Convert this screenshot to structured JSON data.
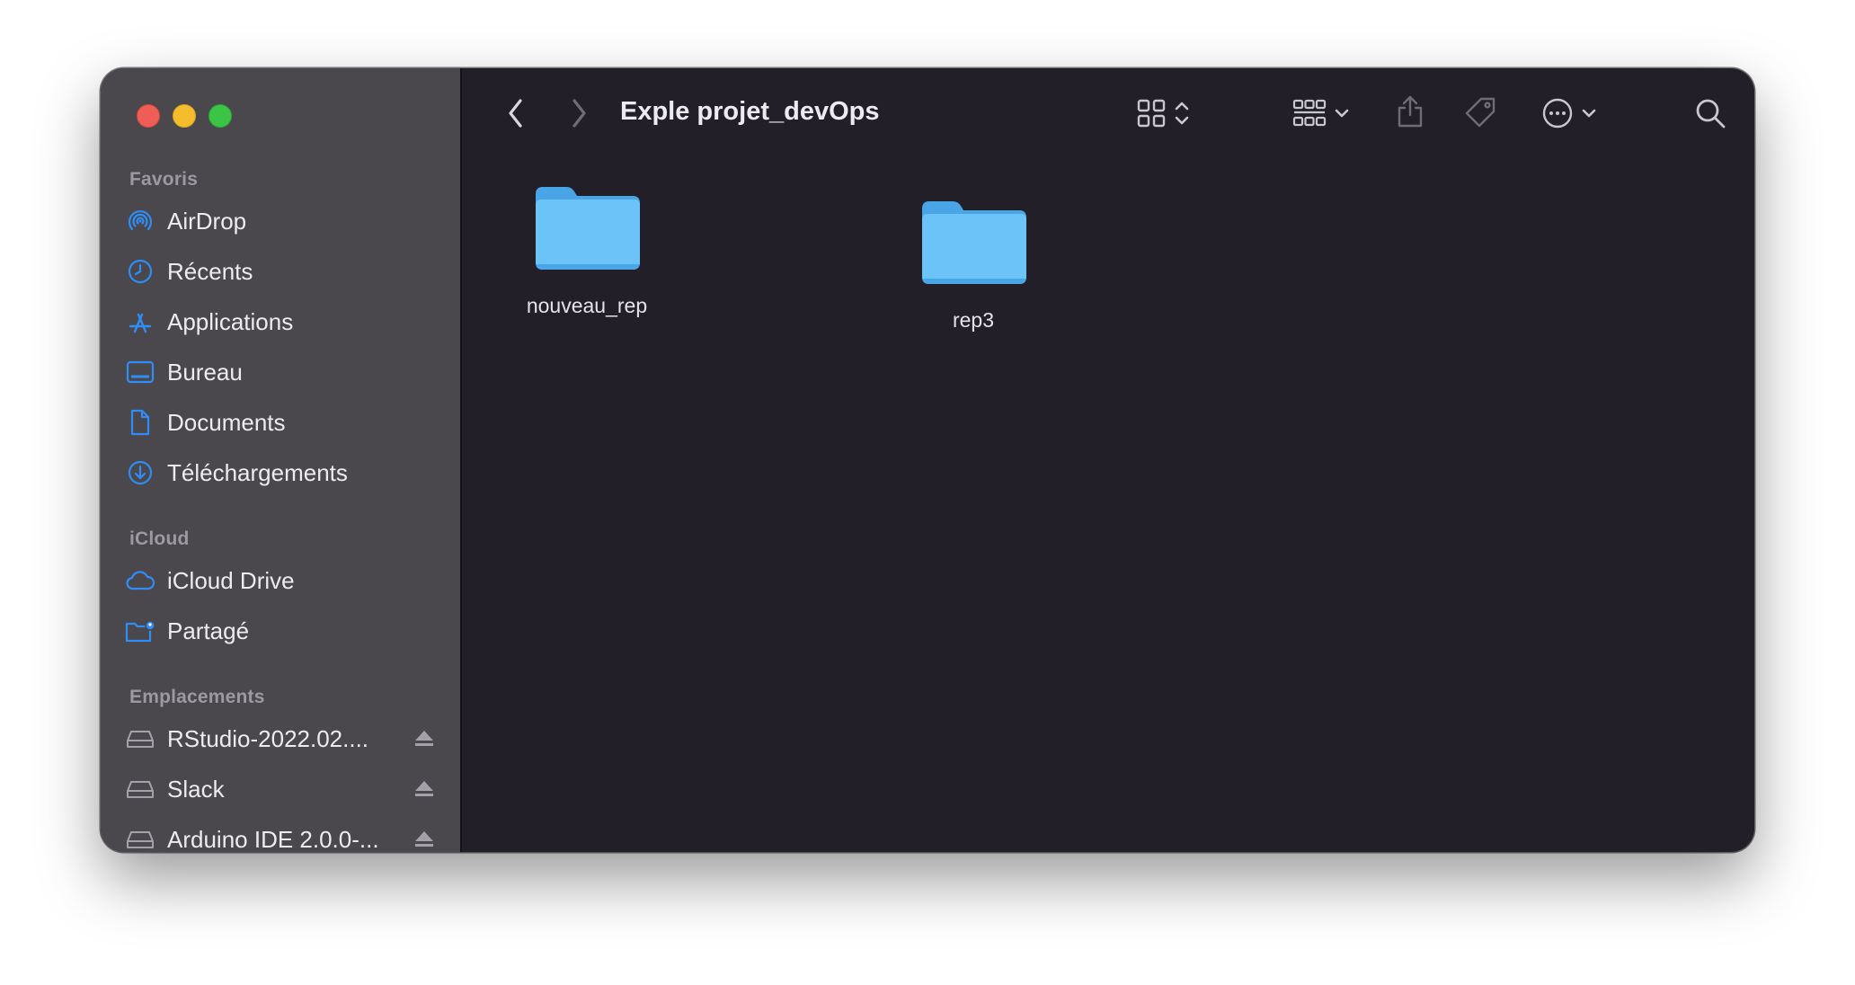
{
  "window": {
    "title": "Exple projet_devOps"
  },
  "sidebar": {
    "sections": {
      "favorites": {
        "header": "Favoris",
        "items": [
          {
            "label": "AirDrop",
            "icon": "airdrop-icon"
          },
          {
            "label": "Récents",
            "icon": "clock-icon"
          },
          {
            "label": "Applications",
            "icon": "applications-icon"
          },
          {
            "label": "Bureau",
            "icon": "desktop-icon"
          },
          {
            "label": "Documents",
            "icon": "document-icon"
          },
          {
            "label": "Téléchargements",
            "icon": "download-icon"
          }
        ]
      },
      "icloud": {
        "header": "iCloud",
        "items": [
          {
            "label": "iCloud Drive",
            "icon": "cloud-icon"
          },
          {
            "label": "Partagé",
            "icon": "shared-folder-icon"
          }
        ]
      },
      "locations": {
        "header": "Emplacements",
        "items": [
          {
            "label": "RStudio-2022.02....",
            "icon": "drive-icon",
            "ejectable": true
          },
          {
            "label": "Slack",
            "icon": "drive-icon",
            "ejectable": true
          },
          {
            "label": "Arduino IDE 2.0.0-...",
            "icon": "drive-icon",
            "ejectable": true
          }
        ]
      }
    }
  },
  "toolbar": {
    "icons": [
      "back-icon",
      "forward-icon",
      "icon-view-icon",
      "group-icon",
      "share-icon",
      "tag-icon",
      "more-icon",
      "search-icon"
    ]
  },
  "files": [
    {
      "name": "nouveau_rep",
      "icon": "folder-icon"
    },
    {
      "name": "rep3",
      "icon": "folder-icon"
    }
  ],
  "colors": {
    "accent": "#2f8df6",
    "sidebar_bg": "#4a484d",
    "content_bg": "#221f28",
    "folder": "#6cc3f7"
  }
}
